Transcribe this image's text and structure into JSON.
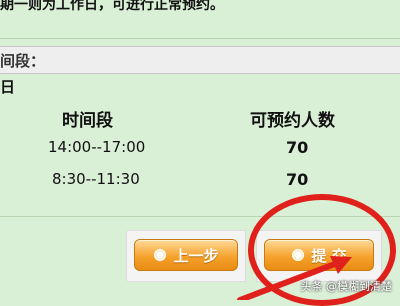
{
  "top_notice": "期一则为工作日，可进行正常预约。",
  "period_title": "间段：",
  "day_label": "日",
  "table": {
    "headers": [
      "时间段",
      "可预约人数"
    ],
    "rows": [
      [
        "14:00--17:00",
        "70"
      ],
      [
        "8:30--11:30",
        "70"
      ]
    ]
  },
  "buttons": {
    "prev_label": "上一步",
    "submit_label": "提 交"
  },
  "watermark": "头条 @模糊到清楚",
  "colors": {
    "background": "#d9efd6",
    "button": "#f5a32d",
    "highlight": "#e0201a"
  }
}
